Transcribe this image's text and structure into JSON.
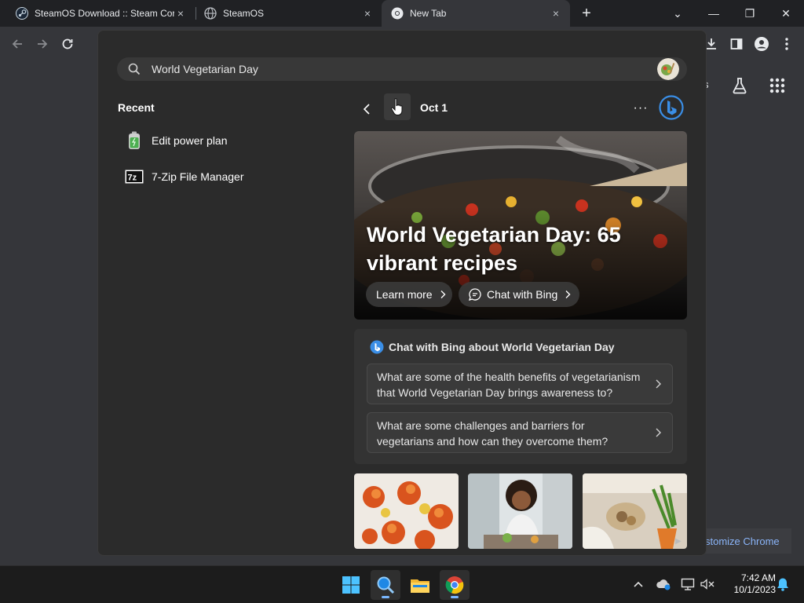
{
  "browser": {
    "tabs": [
      {
        "title": "SteamOS Download :: Steam Cor",
        "icon": "steam-icon",
        "active": false
      },
      {
        "title": "SteamOS",
        "icon": "globe-icon",
        "active": false
      },
      {
        "title": "New Tab",
        "icon": "chrome-icon",
        "active": true
      }
    ],
    "new_tab_symbol": "+",
    "close_symbol": "×",
    "window_controls": {
      "tab_search": "⌄",
      "minimize": "—",
      "restore": "❐",
      "close": "✕"
    }
  },
  "ntp": {
    "partial_label": "s",
    "customize_label": "stomize Chrome"
  },
  "search": {
    "query": "World Vegetarian Day",
    "recent_heading": "Recent",
    "recent_items": [
      {
        "label": "Edit power plan",
        "icon": "battery-icon"
      },
      {
        "label": "7-Zip File Manager",
        "icon": "7zip-icon"
      }
    ],
    "date_label": "Oct 1",
    "more_symbol": "···",
    "hero": {
      "title": "World Vegetarian Day: 65 vibrant recipes",
      "learn_more": "Learn more",
      "chat_with_bing": "Chat with Bing"
    },
    "chat": {
      "heading": "Chat with Bing about World Vegetarian Day",
      "questions": [
        "What are some of the health benefits of vegetarianism that World Vegetarian Day brings awareness to?",
        "What are some challenges and barriers for vegetarians and how can they overcome them?"
      ]
    }
  },
  "taskbar": {
    "apps": [
      "windows-start-icon",
      "search-icon",
      "file-explorer-icon",
      "chrome-icon"
    ],
    "time": "7:42 AM",
    "date": "10/1/2023"
  },
  "colors": {
    "accent_blue": "#8ab4f8",
    "flyout_bg": "#2b2b2b",
    "taskbar_bg": "#1c1c1c"
  }
}
